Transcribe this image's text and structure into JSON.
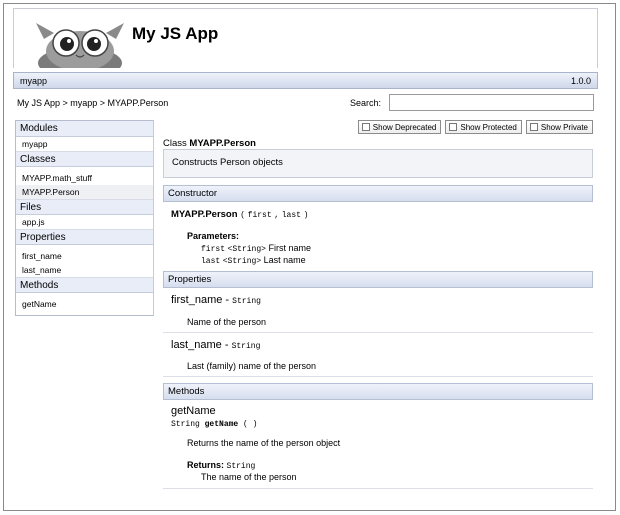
{
  "header": {
    "title": "My JS App"
  },
  "module_bar": {
    "module": "myapp",
    "version": "1.0.0"
  },
  "nav": {
    "breadcrumb": "My JS App > myapp > MYAPP.Person",
    "search_label": "Search:",
    "search_value": ""
  },
  "sidebar": {
    "sections": [
      {
        "title": "Modules",
        "items": [
          "myapp"
        ]
      },
      {
        "title": "Classes",
        "items": [
          "MYAPP.math_stuff",
          "MYAPP.Person"
        ]
      },
      {
        "title": "Files",
        "items": [
          "app.js"
        ]
      },
      {
        "title": "Properties",
        "items": [
          "first_name",
          "last_name"
        ]
      },
      {
        "title": "Methods",
        "items": [
          "getName"
        ]
      }
    ]
  },
  "toggles": [
    "Show Deprecated",
    "Show Protected",
    "Show Private"
  ],
  "class_info": {
    "prefix": "Class",
    "name": "MYAPP.Person",
    "description": "Constructs Person objects"
  },
  "constructor": {
    "heading": "Constructor",
    "name": "MYAPP.Person",
    "open_paren": "(",
    "arg1": "first",
    "comma": ",",
    "arg2": "last",
    "close_paren": ")",
    "params_heading": "Parameters:",
    "params": [
      {
        "name": "first",
        "type": "<String>",
        "desc": "First name"
      },
      {
        "name": "last",
        "type": "<String>",
        "desc": "Last name"
      }
    ]
  },
  "properties": {
    "heading": "Properties",
    "items": [
      {
        "name": "first_name",
        "sep": "-",
        "type": "String",
        "desc": "Name of the person"
      },
      {
        "name": "last_name",
        "sep": "-",
        "type": "String",
        "desc": "Last (family) name of the person"
      }
    ]
  },
  "methods": {
    "heading": "Methods",
    "name": "getName",
    "sig_type": "String",
    "sig_name": "getName",
    "sig_parens": "( )",
    "desc": "Returns the name of the person object",
    "returns_label": "Returns:",
    "returns_type": "String",
    "returns_desc": "The name of the person"
  },
  "colors": {
    "section_bar": "#dde4f2",
    "border": "#b4bfd4"
  }
}
